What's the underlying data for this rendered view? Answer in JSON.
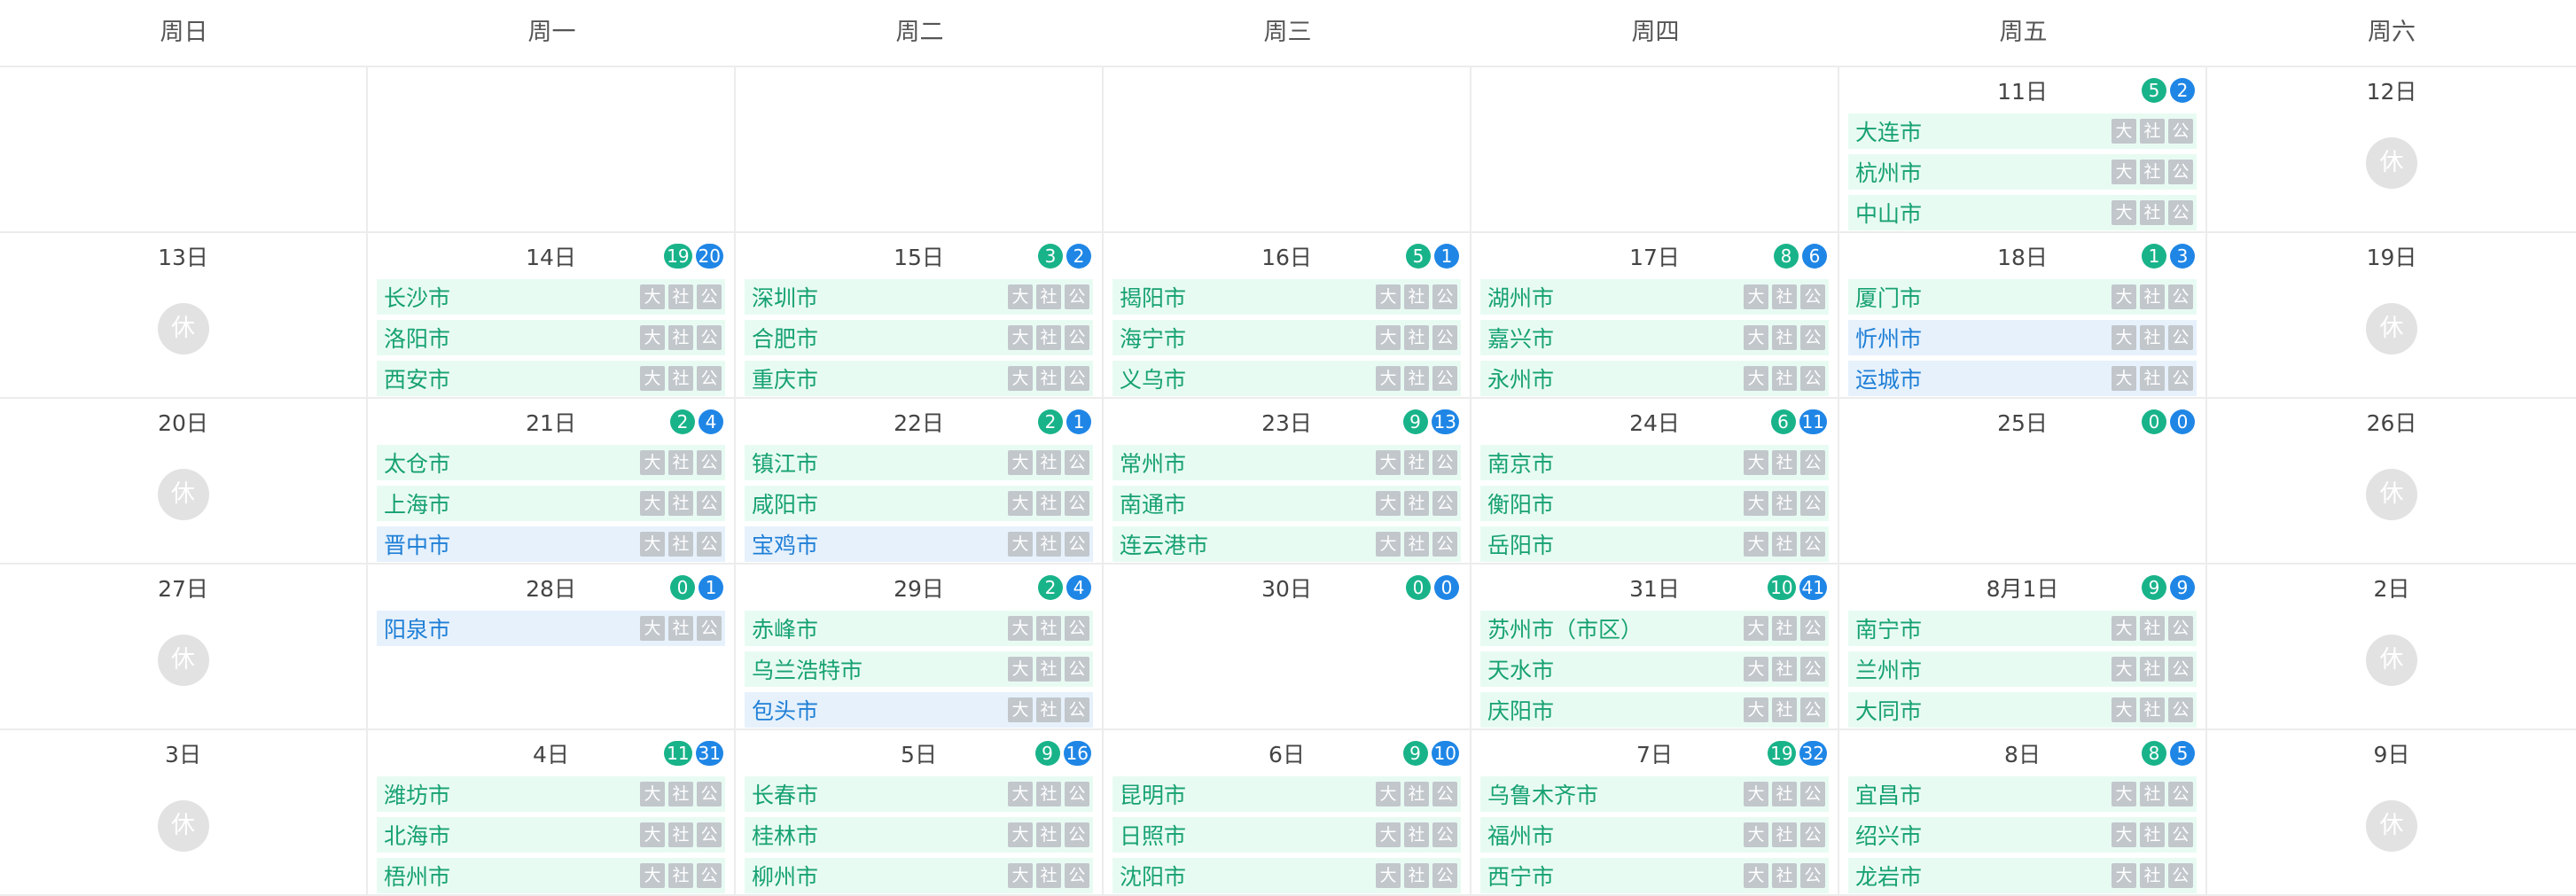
{
  "colors": {
    "green_badge": "#19b38a",
    "blue_badge": "#1f86e6",
    "green_event": "#e8fbf3",
    "blue_event": "#e6f1fc",
    "rest_circle": "#e2e2e2"
  },
  "tag_labels": [
    "大",
    "社",
    "公"
  ],
  "rest_label": "休",
  "weekdays": [
    "周日",
    "周一",
    "周二",
    "周三",
    "周四",
    "周五",
    "周六"
  ],
  "weeks": [
    [
      {
        "date": ""
      },
      {
        "date": ""
      },
      {
        "date": ""
      },
      {
        "date": ""
      },
      {
        "date": ""
      },
      {
        "date": "11日",
        "green": "5",
        "blue": "2",
        "events": [
          {
            "name": "大连市",
            "type": "green"
          },
          {
            "name": "杭州市",
            "type": "green"
          },
          {
            "name": "中山市",
            "type": "green"
          }
        ]
      },
      {
        "date": "12日",
        "rest": true
      }
    ],
    [
      {
        "date": "13日",
        "rest": true
      },
      {
        "date": "14日",
        "green": "19",
        "blue": "20",
        "events": [
          {
            "name": "长沙市",
            "type": "green"
          },
          {
            "name": "洛阳市",
            "type": "green"
          },
          {
            "name": "西安市",
            "type": "green"
          }
        ]
      },
      {
        "date": "15日",
        "green": "3",
        "blue": "2",
        "events": [
          {
            "name": "深圳市",
            "type": "green"
          },
          {
            "name": "合肥市",
            "type": "green"
          },
          {
            "name": "重庆市",
            "type": "green"
          }
        ]
      },
      {
        "date": "16日",
        "green": "5",
        "blue": "1",
        "events": [
          {
            "name": "揭阳市",
            "type": "green"
          },
          {
            "name": "海宁市",
            "type": "green"
          },
          {
            "name": "义乌市",
            "type": "green"
          }
        ]
      },
      {
        "date": "17日",
        "green": "8",
        "blue": "6",
        "events": [
          {
            "name": "湖州市",
            "type": "green"
          },
          {
            "name": "嘉兴市",
            "type": "green"
          },
          {
            "name": "永州市",
            "type": "green"
          }
        ]
      },
      {
        "date": "18日",
        "green": "1",
        "blue": "3",
        "events": [
          {
            "name": "厦门市",
            "type": "green"
          },
          {
            "name": "忻州市",
            "type": "blue"
          },
          {
            "name": "运城市",
            "type": "blue"
          }
        ]
      },
      {
        "date": "19日",
        "rest": true
      }
    ],
    [
      {
        "date": "20日",
        "rest": true
      },
      {
        "date": "21日",
        "green": "2",
        "blue": "4",
        "events": [
          {
            "name": "太仓市",
            "type": "green"
          },
          {
            "name": "上海市",
            "type": "green"
          },
          {
            "name": "晋中市",
            "type": "blue"
          }
        ]
      },
      {
        "date": "22日",
        "green": "2",
        "blue": "1",
        "events": [
          {
            "name": "镇江市",
            "type": "green"
          },
          {
            "name": "咸阳市",
            "type": "green"
          },
          {
            "name": "宝鸡市",
            "type": "blue"
          }
        ]
      },
      {
        "date": "23日",
        "green": "9",
        "blue": "13",
        "events": [
          {
            "name": "常州市",
            "type": "green"
          },
          {
            "name": "南通市",
            "type": "green"
          },
          {
            "name": "连云港市",
            "type": "green"
          }
        ]
      },
      {
        "date": "24日",
        "green": "6",
        "blue": "11",
        "events": [
          {
            "name": "南京市",
            "type": "green"
          },
          {
            "name": "衡阳市",
            "type": "green"
          },
          {
            "name": "岳阳市",
            "type": "green"
          }
        ]
      },
      {
        "date": "25日",
        "green": "0",
        "blue": "0",
        "events": []
      },
      {
        "date": "26日",
        "rest": true
      }
    ],
    [
      {
        "date": "27日",
        "rest": true
      },
      {
        "date": "28日",
        "green": "0",
        "blue": "1",
        "events": [
          {
            "name": "阳泉市",
            "type": "blue"
          }
        ]
      },
      {
        "date": "29日",
        "green": "2",
        "blue": "4",
        "events": [
          {
            "name": "赤峰市",
            "type": "green"
          },
          {
            "name": "乌兰浩特市",
            "type": "green"
          },
          {
            "name": "包头市",
            "type": "blue"
          }
        ]
      },
      {
        "date": "30日",
        "green": "0",
        "blue": "0",
        "events": []
      },
      {
        "date": "31日",
        "green": "10",
        "blue": "41",
        "events": [
          {
            "name": "苏州市（市区）",
            "type": "green"
          },
          {
            "name": "天水市",
            "type": "green"
          },
          {
            "name": "庆阳市",
            "type": "green"
          }
        ]
      },
      {
        "date": "8月1日",
        "green": "9",
        "blue": "9",
        "events": [
          {
            "name": "南宁市",
            "type": "green"
          },
          {
            "name": "兰州市",
            "type": "green"
          },
          {
            "name": "大同市",
            "type": "green"
          }
        ]
      },
      {
        "date": "2日",
        "rest": true
      }
    ],
    [
      {
        "date": "3日",
        "rest": true
      },
      {
        "date": "4日",
        "green": "11",
        "blue": "31",
        "events": [
          {
            "name": "潍坊市",
            "type": "green"
          },
          {
            "name": "北海市",
            "type": "green"
          },
          {
            "name": "梧州市",
            "type": "green"
          }
        ]
      },
      {
        "date": "5日",
        "green": "9",
        "blue": "16",
        "events": [
          {
            "name": "长春市",
            "type": "green"
          },
          {
            "name": "桂林市",
            "type": "green"
          },
          {
            "name": "柳州市",
            "type": "green"
          }
        ]
      },
      {
        "date": "6日",
        "green": "9",
        "blue": "10",
        "events": [
          {
            "name": "昆明市",
            "type": "green"
          },
          {
            "name": "日照市",
            "type": "green"
          },
          {
            "name": "沈阳市",
            "type": "green"
          }
        ]
      },
      {
        "date": "7日",
        "green": "19",
        "blue": "32",
        "events": [
          {
            "name": "乌鲁木齐市",
            "type": "green"
          },
          {
            "name": "福州市",
            "type": "green"
          },
          {
            "name": "西宁市",
            "type": "green"
          }
        ]
      },
      {
        "date": "8日",
        "green": "8",
        "blue": "5",
        "events": [
          {
            "name": "宜昌市",
            "type": "green"
          },
          {
            "name": "绍兴市",
            "type": "green"
          },
          {
            "name": "龙岩市",
            "type": "green"
          }
        ]
      },
      {
        "date": "9日",
        "rest": true
      }
    ]
  ]
}
